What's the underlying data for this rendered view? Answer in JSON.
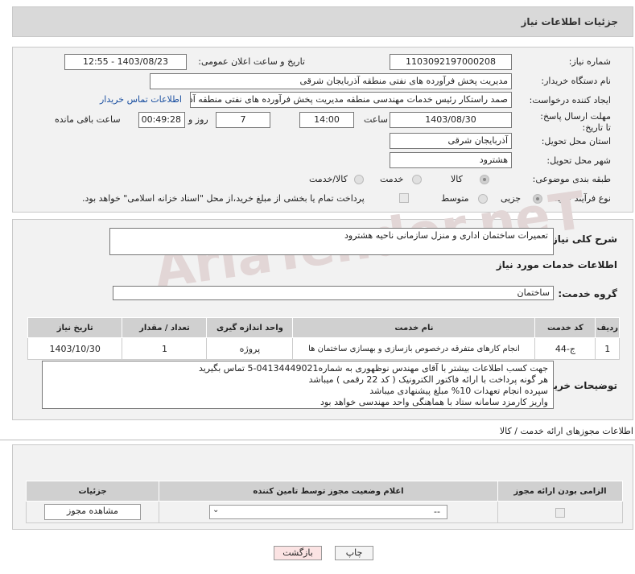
{
  "header": {
    "title": "جزئیات اطلاعات نیاز"
  },
  "info": {
    "need_number_label": "شماره نیاز:",
    "need_number": "1103092197000208",
    "announce_label": "تاریخ و ساعت اعلان عمومی:",
    "announce_value": "1403/08/23 - 12:55",
    "buyer_org_label": "نام دستگاه خریدار:",
    "buyer_org": "مدیریت پخش فرآورده های نفتی منطقه آذربایجان شرقی",
    "requester_label": "ایجاد کننده درخواست:",
    "requester": "صمد راستکار رئیس خدمات مهندسی منطقه مدیریت پخش فرآورده های نفتی منطقه آذربایجان شرقی",
    "contact_link": "اطلاعات تماس خریدار",
    "deadline_label": "مهلت ارسال پاسخ: تا تاریخ:",
    "deadline_date": "1403/08/30",
    "time_label": "ساعت",
    "deadline_time": "14:00",
    "days_value": "7",
    "days_label": "روز و",
    "remaining_time": "00:49:28",
    "remaining_label": "ساعت باقی مانده",
    "province_label": "استان محل تحویل:",
    "province": "آذربایجان شرقی",
    "city_label": "شهر محل تحویل:",
    "city": "هشترود",
    "category_label": "طبقه بندی موضوعی:",
    "category_options": [
      "کالا",
      "خدمت",
      "کالا/خدمت"
    ],
    "category_selected": "کالا",
    "process_label": "نوع فرآیند خرید :",
    "process_options": [
      "جزیی",
      "متوسط"
    ],
    "process_selected": "جزیی",
    "treasury_note": "پرداخت تمام یا بخشی از مبلغ خرید،از محل \"اسناد خزانه اسلامی\" خواهد بود."
  },
  "description": {
    "label": "شرح کلی نیاز:",
    "value": "تعمیرات ساختمان اداری و منزل سازمانی ناحیه هشترود"
  },
  "services": {
    "title": "اطلاعات خدمات مورد نیاز",
    "group_label": "گروه خدمت:",
    "group_value": "ساختمان",
    "columns": [
      "ردیف",
      "کد خدمت",
      "نام خدمت",
      "واحد اندازه گیری",
      "تعداد / مقدار",
      "تاریخ نیاز"
    ],
    "rows": [
      [
        "1",
        "ج-44",
        "انجام کارهای متفرقه درخصوص بازسازی و بهسازی ساختمان ها",
        "پروژه",
        "1",
        "1403/10/30"
      ]
    ]
  },
  "buyer_notes": {
    "label": "توضیحات خریدار:",
    "lines": [
      "جهت کسب اطلاعات بیشتر با آقای مهندس نوظهوری به شماره04134449021-5 تماس بگیرید",
      "هر گونه پرداخت با ارائه فاکتور الکترونیک ( کد 22 رقمی ) میباشد",
      "سپرده انجام تعهدات 10%  مبلغ پیشنهادی میباشد",
      "واریز کارمزد سامانه ستاد با هماهنگی واحد مهندسی خواهد بود"
    ]
  },
  "permits": {
    "title": "اطلاعات مجوزهای ارائه خدمت / کالا",
    "columns": [
      "الزامی بودن ارائه مجوز",
      "اعلام وضعیت مجوز توسط تامین کننده",
      "جزئیات"
    ],
    "select_value": "--",
    "view_button": "مشاهده مجوز"
  },
  "footer": {
    "print_label": "چاپ",
    "back_label": "بازگشت"
  },
  "watermark": "AriaTender.neT",
  "colors": {
    "header_bg": "#d9d9d9",
    "panel_bg": "#f2f2f2",
    "link": "#1a4fa0",
    "back_btn": "#fbe3e3"
  }
}
